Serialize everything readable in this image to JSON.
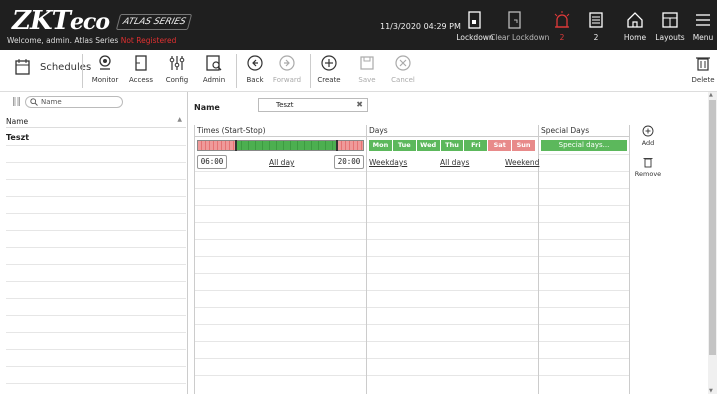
{
  "header": {
    "logo_main": "ZKT",
    "logo_sub": "eco",
    "series_badge": "ATLAS SERIES",
    "welcome": "Welcome, admin.",
    "product": "Atlas Series",
    "registration": "Not Registered",
    "datetime": "11/3/2020 04:29 PM",
    "buttons": [
      {
        "label": "Lockdown",
        "icon": "lockdown-icon"
      },
      {
        "label": "Clear Lockdown",
        "icon": "clear-lockdown-icon"
      },
      {
        "label": "2",
        "icon": "alarm-icon"
      },
      {
        "label": "2",
        "icon": "events-icon"
      },
      {
        "label": "Home",
        "icon": "home-icon"
      },
      {
        "label": "Layouts",
        "icon": "layouts-icon"
      },
      {
        "label": "Menu",
        "icon": "menu-icon"
      }
    ]
  },
  "toolbar": {
    "section": "Schedules",
    "buttons": [
      {
        "label": "Monitor"
      },
      {
        "label": "Access"
      },
      {
        "label": "Config"
      },
      {
        "label": "Admin"
      },
      {
        "label": "Back"
      },
      {
        "label": "Forward"
      },
      {
        "label": "Create"
      },
      {
        "label": "Save"
      },
      {
        "label": "Cancel"
      },
      {
        "label": "Delete"
      }
    ]
  },
  "list": {
    "search_placeholder": "Name",
    "column": "Name",
    "items": [
      "Teszt"
    ]
  },
  "form": {
    "name_label": "Name",
    "name_value": "Teszt"
  },
  "grid": {
    "headers": [
      "Times (Start-Stop)",
      "Days",
      "Special Days"
    ],
    "start_time": "06:00",
    "end_time": "20:00",
    "all_day": "All day",
    "days": [
      "Mon",
      "Tue",
      "Wed",
      "Thu",
      "Fri",
      "Sat",
      "Sun"
    ],
    "weekdays_link": "Weekdays",
    "all_days_link": "All days",
    "weekend_link": "Weekend",
    "special_days_button": "Special days..."
  },
  "side": {
    "add": "Add",
    "remove": "Remove"
  }
}
